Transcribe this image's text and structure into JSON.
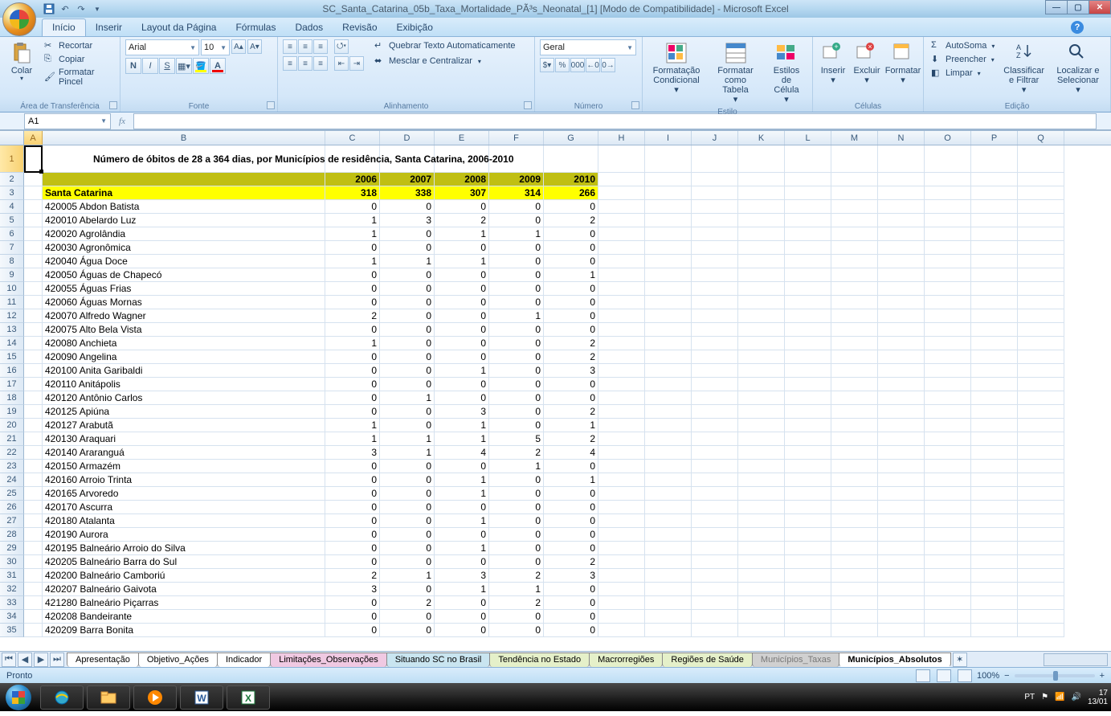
{
  "window": {
    "title": "SC_Santa_Catarina_05b_Taxa_Mortalidade_PÃ³s_Neonatal_[1]  [Modo de Compatibilidade] - Microsoft Excel"
  },
  "tabs": [
    "Início",
    "Inserir",
    "Layout da Página",
    "Fórmulas",
    "Dados",
    "Revisão",
    "Exibição"
  ],
  "clipboard": {
    "paste": "Colar",
    "cut": "Recortar",
    "copy": "Copiar",
    "fp": "Formatar Pincel",
    "group": "Área de Transferência"
  },
  "font": {
    "name": "Arial",
    "size": "10",
    "group": "Fonte"
  },
  "align": {
    "wrap": "Quebrar Texto Automaticamente",
    "merge": "Mesclar e Centralizar",
    "group": "Alinhamento"
  },
  "number": {
    "format": "Geral",
    "group": "Número"
  },
  "styles": {
    "cond": "Formatação Condicional",
    "table": "Formatar como Tabela",
    "cell": "Estilos de Célula",
    "group": "Estilo"
  },
  "cellsg": {
    "insert": "Inserir",
    "delete": "Excluir",
    "format": "Formatar",
    "group": "Células"
  },
  "editing": {
    "sum": "AutoSoma",
    "fill": "Preencher",
    "clear": "Limpar",
    "sort": "Classificar e Filtrar",
    "find": "Localizar e Selecionar",
    "group": "Edição"
  },
  "namebox": "A1",
  "columns": [
    "A",
    "B",
    "C",
    "D",
    "E",
    "F",
    "G",
    "H",
    "I",
    "J",
    "K",
    "L",
    "M",
    "N",
    "O",
    "P",
    "Q"
  ],
  "sheet_title": "Número de óbitos de 28 a 364 dias, por Municípios de residência, Santa Catarina, 2006-2010",
  "years": [
    "2006",
    "2007",
    "2008",
    "2009",
    "2010"
  ],
  "state_row": {
    "label": "Santa Catarina",
    "v": [
      "318",
      "338",
      "307",
      "314",
      "266"
    ]
  },
  "rows": [
    {
      "c": "420005",
      "n": "Abdon Batista",
      "v": [
        "0",
        "0",
        "0",
        "0",
        "0"
      ]
    },
    {
      "c": "420010",
      "n": "Abelardo Luz",
      "v": [
        "1",
        "3",
        "2",
        "0",
        "2"
      ]
    },
    {
      "c": "420020",
      "n": "Agrolândia",
      "v": [
        "1",
        "0",
        "1",
        "1",
        "0"
      ]
    },
    {
      "c": "420030",
      "n": "Agronômica",
      "v": [
        "0",
        "0",
        "0",
        "0",
        "0"
      ]
    },
    {
      "c": "420040",
      "n": "Água Doce",
      "v": [
        "1",
        "1",
        "1",
        "0",
        "0"
      ]
    },
    {
      "c": "420050",
      "n": "Águas de Chapecó",
      "v": [
        "0",
        "0",
        "0",
        "0",
        "1"
      ]
    },
    {
      "c": "420055",
      "n": "Águas Frias",
      "v": [
        "0",
        "0",
        "0",
        "0",
        "0"
      ]
    },
    {
      "c": "420060",
      "n": "Águas Mornas",
      "v": [
        "0",
        "0",
        "0",
        "0",
        "0"
      ]
    },
    {
      "c": "420070",
      "n": "Alfredo Wagner",
      "v": [
        "2",
        "0",
        "0",
        "1",
        "0"
      ]
    },
    {
      "c": "420075",
      "n": "Alto Bela Vista",
      "v": [
        "0",
        "0",
        "0",
        "0",
        "0"
      ]
    },
    {
      "c": "420080",
      "n": "Anchieta",
      "v": [
        "1",
        "0",
        "0",
        "0",
        "2"
      ]
    },
    {
      "c": "420090",
      "n": "Angelina",
      "v": [
        "0",
        "0",
        "0",
        "0",
        "2"
      ]
    },
    {
      "c": "420100",
      "n": "Anita Garibaldi",
      "v": [
        "0",
        "0",
        "1",
        "0",
        "3"
      ]
    },
    {
      "c": "420110",
      "n": "Anitápolis",
      "v": [
        "0",
        "0",
        "0",
        "0",
        "0"
      ]
    },
    {
      "c": "420120",
      "n": "Antônio Carlos",
      "v": [
        "0",
        "1",
        "0",
        "0",
        "0"
      ]
    },
    {
      "c": "420125",
      "n": "Apiúna",
      "v": [
        "0",
        "0",
        "3",
        "0",
        "2"
      ]
    },
    {
      "c": "420127",
      "n": "Arabutã",
      "v": [
        "1",
        "0",
        "1",
        "0",
        "1"
      ]
    },
    {
      "c": "420130",
      "n": "Araquari",
      "v": [
        "1",
        "1",
        "1",
        "5",
        "2"
      ]
    },
    {
      "c": "420140",
      "n": "Araranguá",
      "v": [
        "3",
        "1",
        "4",
        "2",
        "4"
      ]
    },
    {
      "c": "420150",
      "n": "Armazém",
      "v": [
        "0",
        "0",
        "0",
        "1",
        "0"
      ]
    },
    {
      "c": "420160",
      "n": "Arroio Trinta",
      "v": [
        "0",
        "0",
        "1",
        "0",
        "1"
      ]
    },
    {
      "c": "420165",
      "n": "Arvoredo",
      "v": [
        "0",
        "0",
        "1",
        "0",
        "0"
      ]
    },
    {
      "c": "420170",
      "n": "Ascurra",
      "v": [
        "0",
        "0",
        "0",
        "0",
        "0"
      ]
    },
    {
      "c": "420180",
      "n": "Atalanta",
      "v": [
        "0",
        "0",
        "1",
        "0",
        "0"
      ]
    },
    {
      "c": "420190",
      "n": "Aurora",
      "v": [
        "0",
        "0",
        "0",
        "0",
        "0"
      ]
    },
    {
      "c": "420195",
      "n": "Balneário Arroio do Silva",
      "v": [
        "0",
        "0",
        "1",
        "0",
        "0"
      ]
    },
    {
      "c": "420205",
      "n": "Balneário Barra do Sul",
      "v": [
        "0",
        "0",
        "0",
        "0",
        "2"
      ]
    },
    {
      "c": "420200",
      "n": "Balneário Camboriú",
      "v": [
        "2",
        "1",
        "3",
        "2",
        "3"
      ]
    },
    {
      "c": "420207",
      "n": "Balneário Gaivota",
      "v": [
        "3",
        "0",
        "1",
        "1",
        "0"
      ]
    },
    {
      "c": "421280",
      "n": "Balneário Piçarras",
      "v": [
        "0",
        "2",
        "0",
        "2",
        "0"
      ]
    },
    {
      "c": "420208",
      "n": "Bandeirante",
      "v": [
        "0",
        "0",
        "0",
        "0",
        "0"
      ]
    },
    {
      "c": "420209",
      "n": "Barra Bonita",
      "v": [
        "0",
        "0",
        "0",
        "0",
        "0"
      ]
    }
  ],
  "sheets": [
    {
      "name": "Apresentação",
      "cls": ""
    },
    {
      "name": "Objetivo_Ações",
      "cls": ""
    },
    {
      "name": "Indicador",
      "cls": ""
    },
    {
      "name": "Limitações_Observações",
      "cls": "c1"
    },
    {
      "name": "Situando SC no Brasil",
      "cls": "c2"
    },
    {
      "name": "Tendência no Estado",
      "cls": "c3"
    },
    {
      "name": "Macrorregiões",
      "cls": "c3"
    },
    {
      "name": "Regiões de Saúde",
      "cls": "c3"
    },
    {
      "name": "Municípios_Taxas",
      "cls": "c4"
    },
    {
      "name": "Municípios_Absolutos",
      "cls": "active"
    }
  ],
  "status": {
    "ready": "Pronto",
    "zoom": "100%",
    "lang": "PT",
    "time": "17",
    "date": "13/01"
  }
}
